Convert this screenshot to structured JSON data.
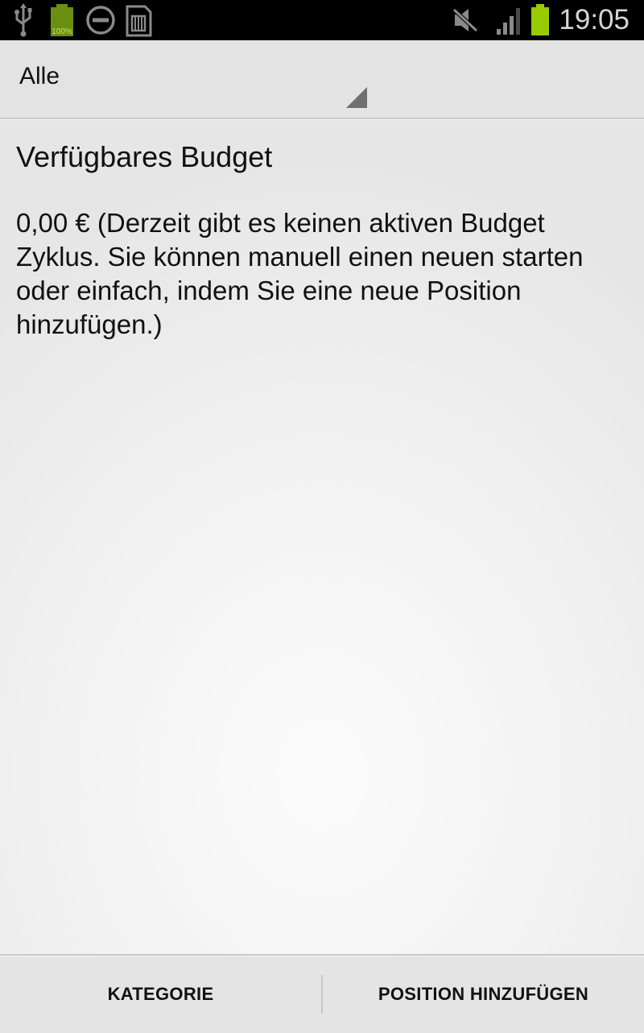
{
  "status_bar": {
    "icons": [
      "usb-icon",
      "battery-full-icon",
      "do-not-disturb-icon",
      "sd-card-icon",
      "mute-icon",
      "signal-icon",
      "battery-icon"
    ],
    "battery_label": "100%",
    "time": "19:05",
    "accent_color": "#99cc00"
  },
  "spinner": {
    "selected": "Alle"
  },
  "content": {
    "title": "Verfügbares Budget",
    "budget_text": "0,00 € (Derzeit gibt es keinen aktiven Budget Zyklus. Sie können manuell einen neuen starten oder einfach, indem Sie eine neue Position hinzufügen.)"
  },
  "bottom_bar": {
    "left_button": "KATEGORIE",
    "right_button": "POSITION HINZUFÜGEN"
  }
}
